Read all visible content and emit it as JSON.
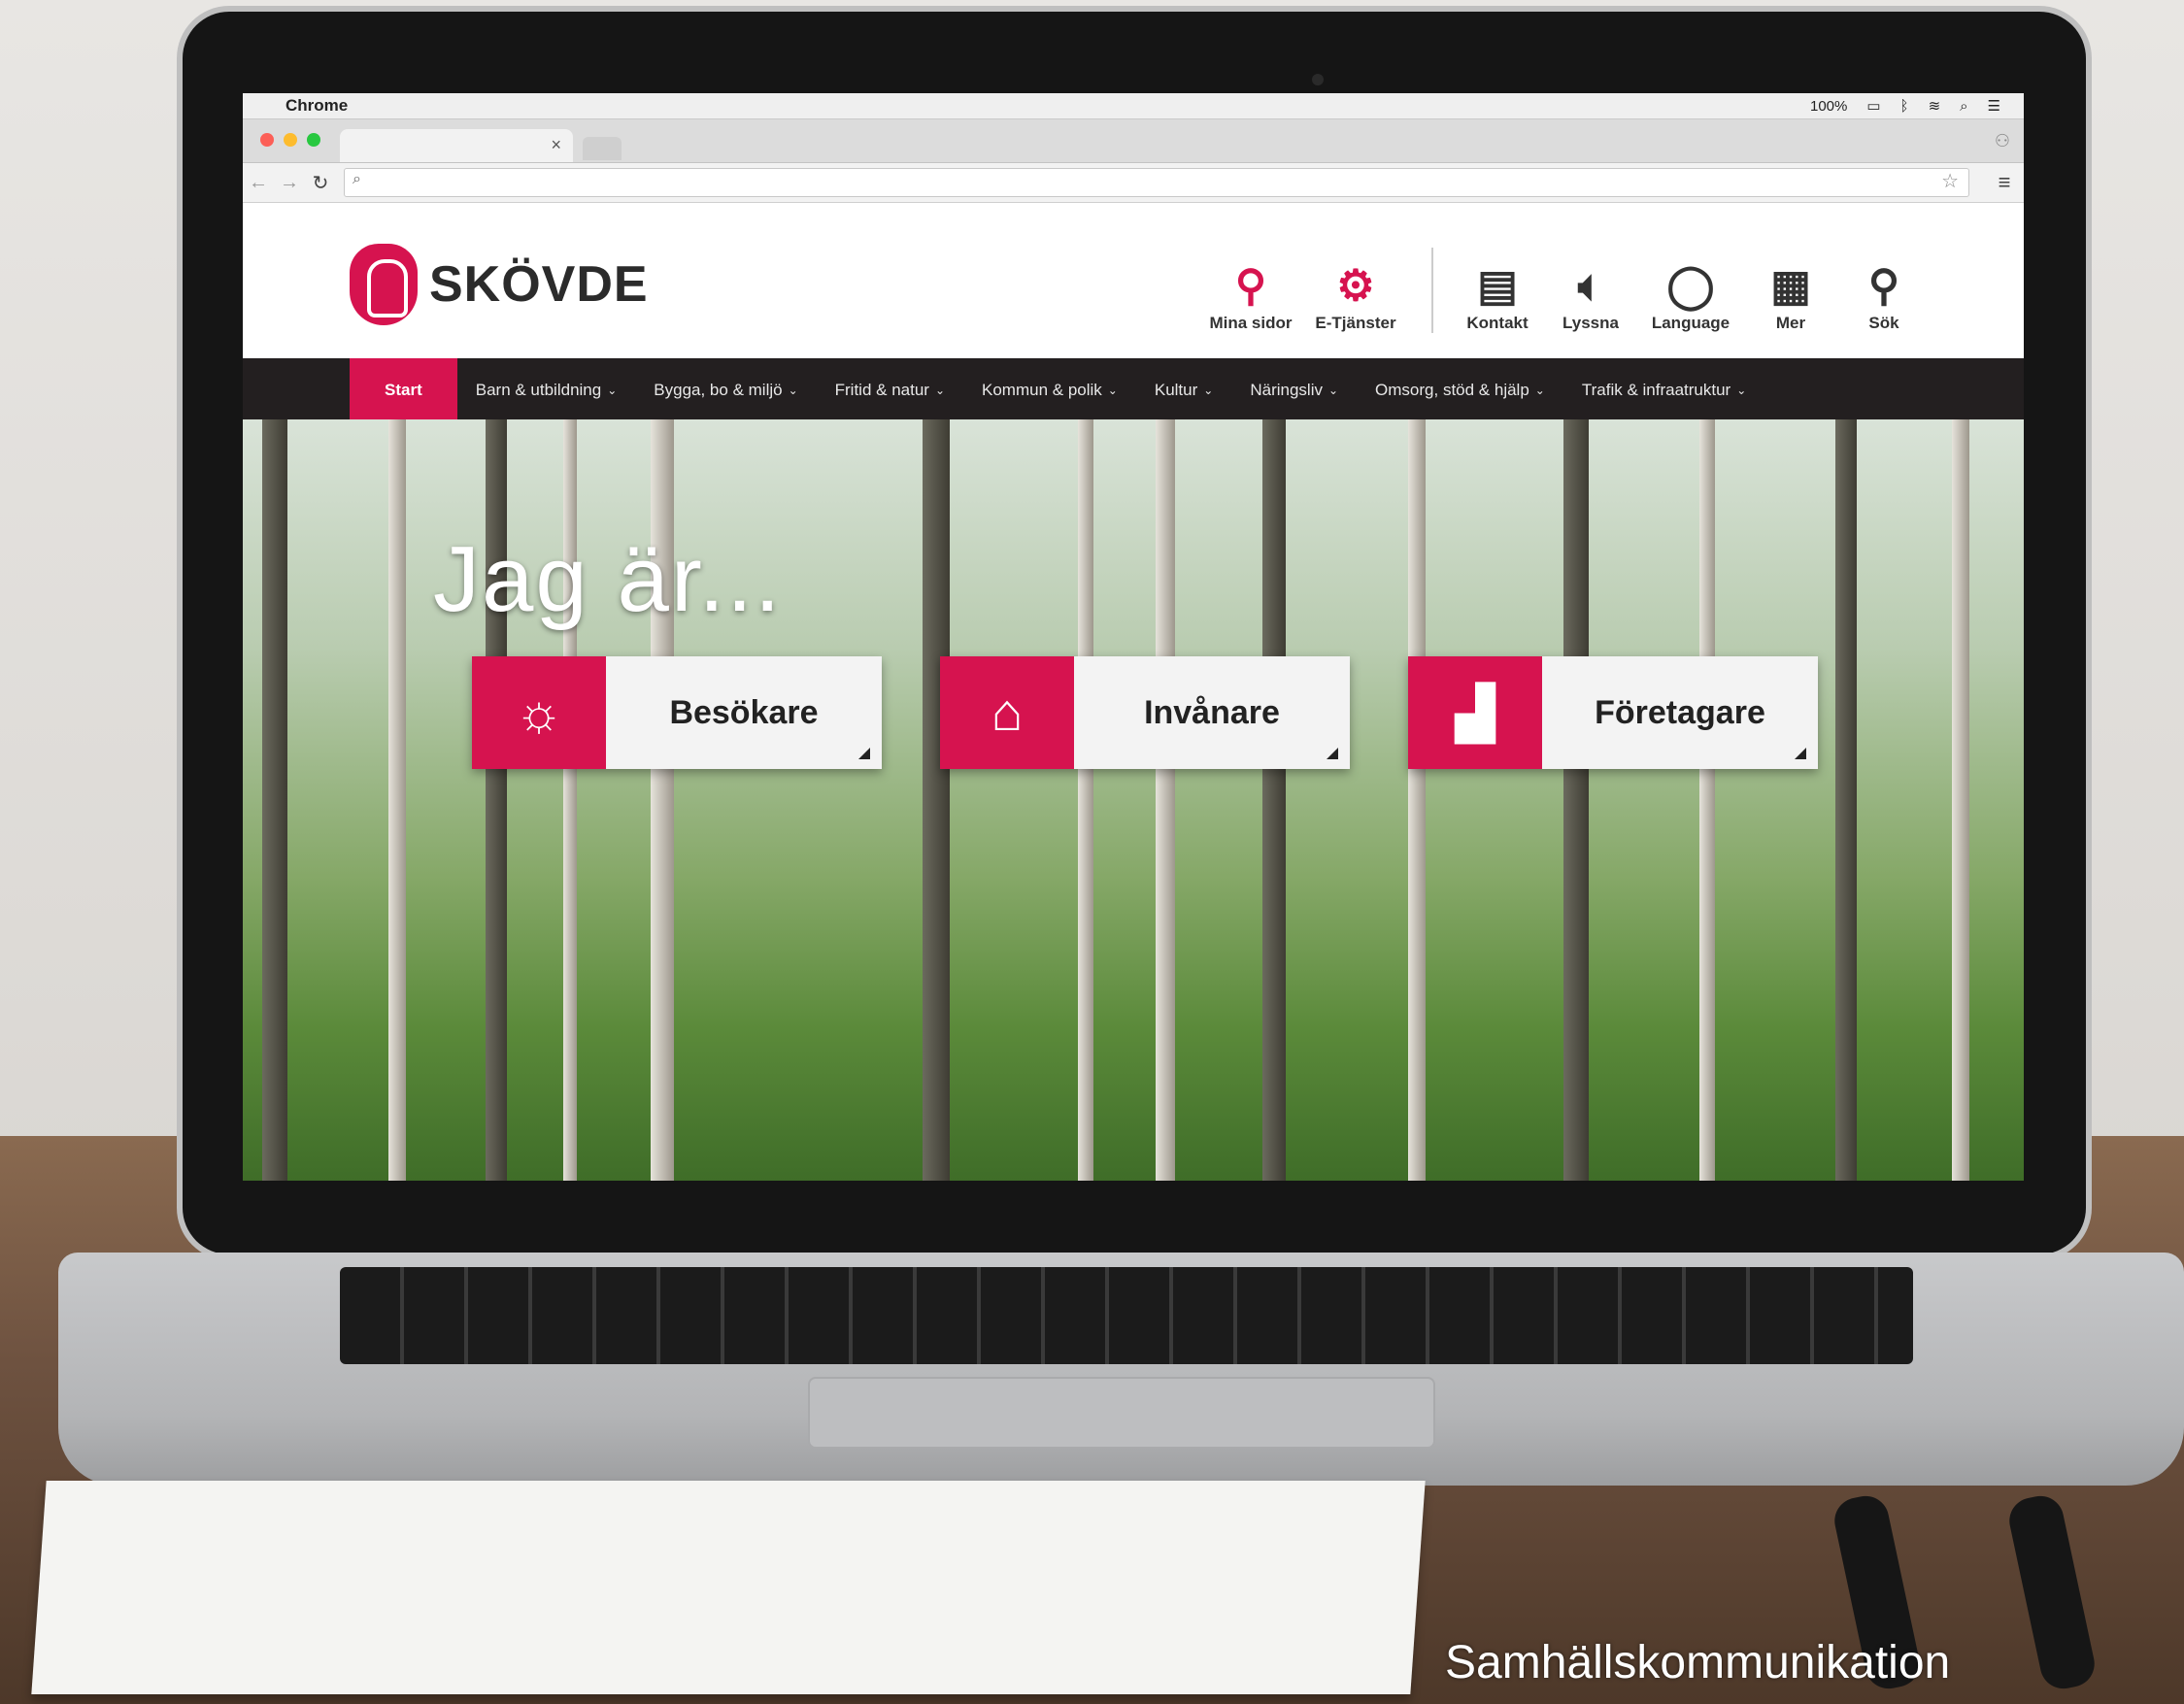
{
  "browser": {
    "app_name": "Chrome",
    "status": {
      "battery": "100%"
    },
    "tab_close": "×"
  },
  "site": {
    "logo_text": "SKÖVDE",
    "tools": [
      {
        "label": "Mina sidor",
        "icon": "person-icon"
      },
      {
        "label": "E-Tjänster",
        "icon": "gear-icon"
      },
      {
        "label": "Kontakt",
        "icon": "contact-card-icon"
      },
      {
        "label": "Lyssna",
        "icon": "speaker-icon"
      },
      {
        "label": "Language",
        "icon": "globe-icon"
      },
      {
        "label": "Mer",
        "icon": "more-icon"
      },
      {
        "label": "Sök",
        "icon": "search-icon"
      }
    ],
    "nav": [
      "Start",
      "Barn & utbildning",
      "Bygga, bo & miljö",
      "Fritid & natur",
      "Kommun & polik",
      "Kultur",
      "Näringsliv",
      "Omsorg, stöd & hjälp",
      "Trafik & infraatruktur"
    ],
    "hero_title": "Jag är...",
    "cards": [
      {
        "label": "Besökare",
        "icon": "trees-sun-icon"
      },
      {
        "label": "Invånare",
        "icon": "town-hall-icon"
      },
      {
        "label": "Företagare",
        "icon": "factory-icon"
      }
    ]
  },
  "caption": "Samhällskommunikation",
  "colors": {
    "brand": "#d6134f",
    "nav_bg": "#231f20"
  }
}
